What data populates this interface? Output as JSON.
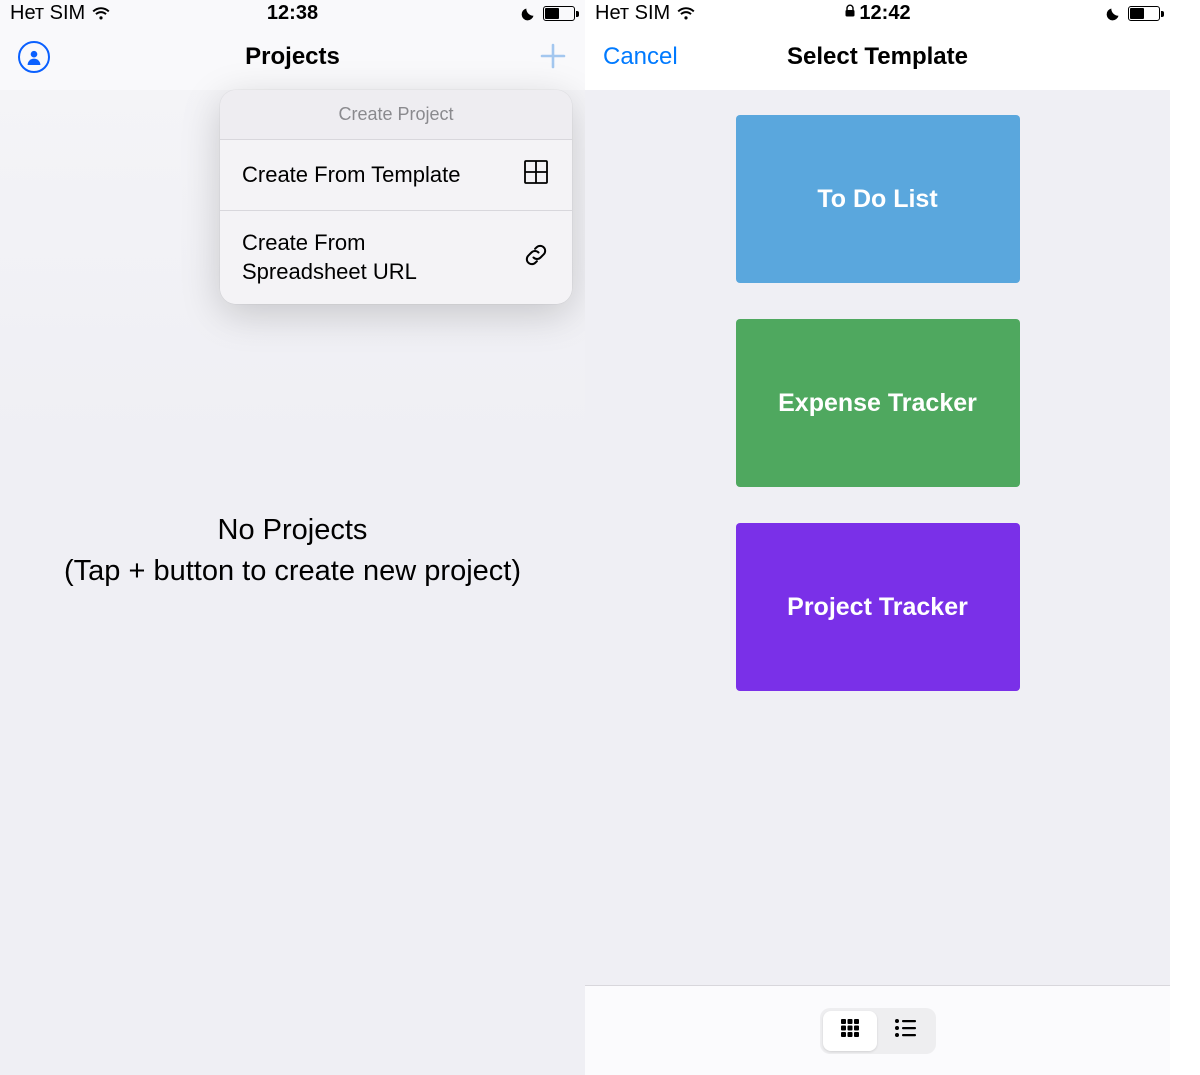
{
  "left": {
    "status": {
      "carrier": "Нет SIM",
      "time": "12:38"
    },
    "nav": {
      "title": "Projects"
    },
    "popover": {
      "header": "Create Project",
      "items": [
        {
          "label": "Create From Template",
          "icon": "template-grid-icon"
        },
        {
          "label": "Create From Spreadsheet URL",
          "icon": "link-icon"
        }
      ]
    },
    "empty": {
      "line1": "No Projects",
      "line2": "(Tap + button to create new project)"
    }
  },
  "right": {
    "status": {
      "carrier": "Нет SIM",
      "time": "12:42"
    },
    "nav": {
      "cancel": "Cancel",
      "title": "Select Template"
    },
    "templates": [
      {
        "label": "To Do List",
        "color": "#5aa7dd"
      },
      {
        "label": "Expense Tracker",
        "color": "#4fa85f"
      },
      {
        "label": "Project Tracker",
        "color": "#7a30e8"
      }
    ]
  }
}
